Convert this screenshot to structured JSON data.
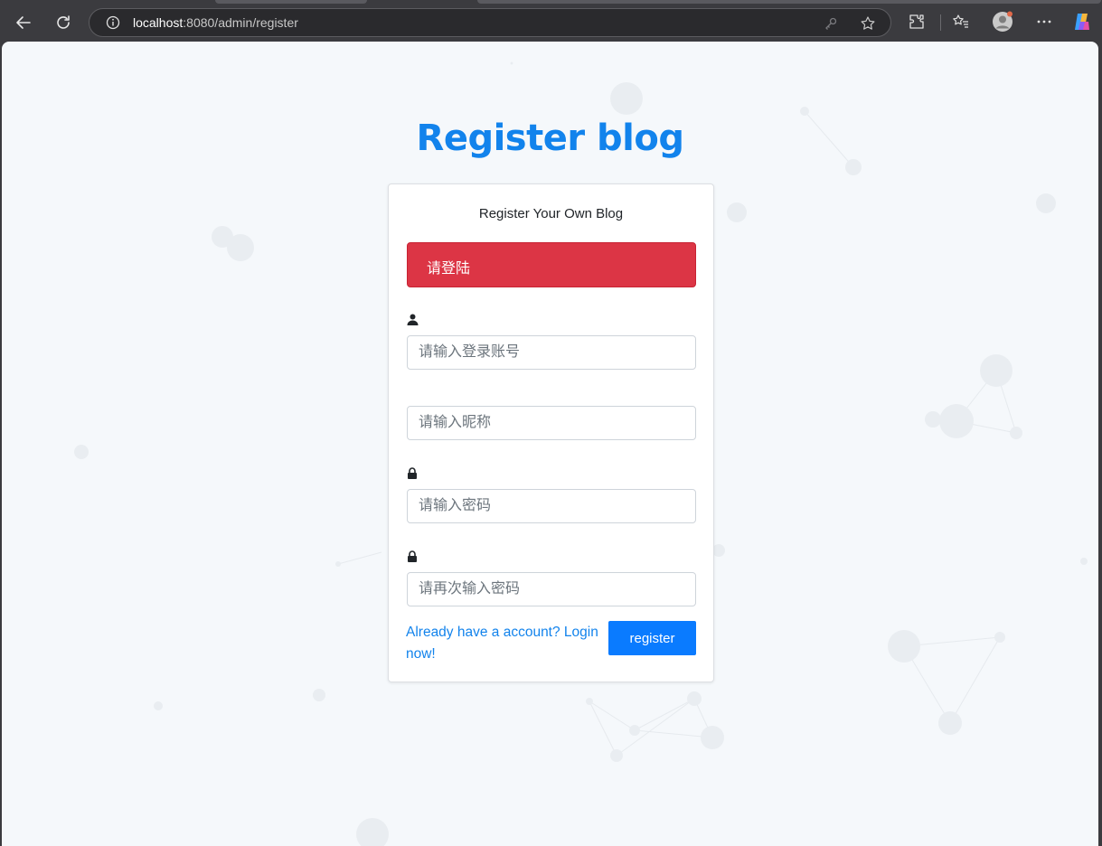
{
  "browser": {
    "url_host": "localhost",
    "url_rest": ":8080/admin/register"
  },
  "page": {
    "title": "Register blog"
  },
  "card": {
    "subtitle": "Register Your Own Blog",
    "alert_text": "请登陆",
    "account_placeholder": "请输入登录账号",
    "nickname_placeholder": "请输入昵称",
    "password_placeholder": "请输入密码",
    "confirm_placeholder": "请再次输入密码",
    "login_link": "Already have a account?  Login now!",
    "register_label": "register"
  },
  "colors": {
    "title": "#1283ec",
    "alert": "#dc3545",
    "button": "#0a7bff",
    "background": "#f5f8fb"
  }
}
